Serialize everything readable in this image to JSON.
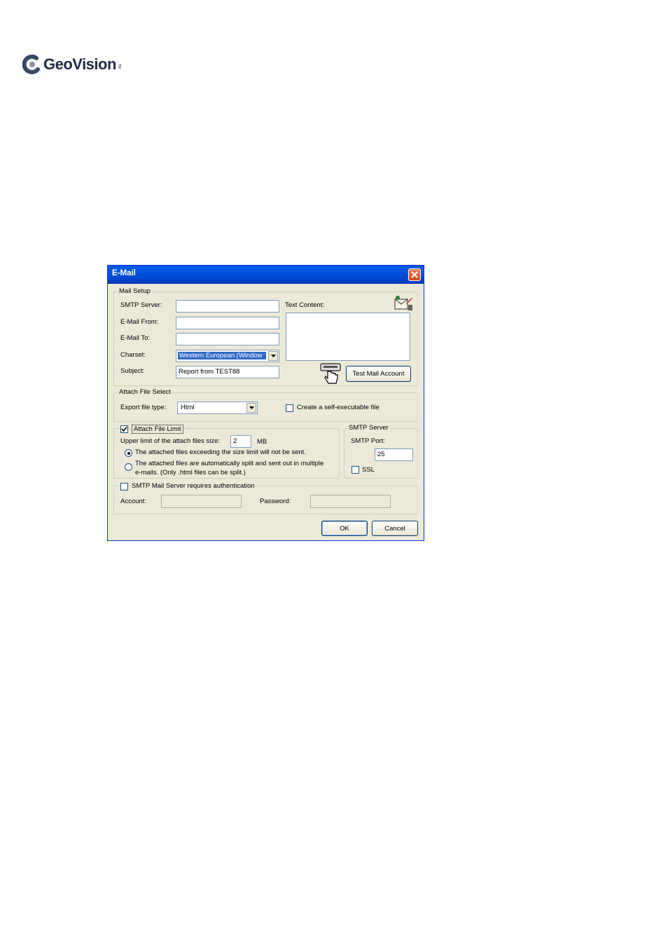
{
  "brand": {
    "name": "GeoVision",
    "tm": "TM"
  },
  "dialog": {
    "title": "E-Mail",
    "mail_setup": {
      "group_label": "Mail Setup",
      "smtp_server_label": "SMTP Server:",
      "smtp_server_value": "",
      "email_from_label": "E-Mail From:",
      "email_from_value": "",
      "email_to_label": "E-Mail To:",
      "email_to_value": "",
      "charset_label": "Charset:",
      "charset_value": "Western European (Window",
      "subject_label": "Subject:",
      "subject_value": "Report from TEST88",
      "text_content_label": "Text Content:",
      "text_content_value": "",
      "test_button_label": "Test Mail Account"
    },
    "attach_file_select": {
      "group_label": "Attach File Select",
      "export_type_label": "Export file type:",
      "export_type_value": "Html",
      "self_exec_label": "Create a self-executable file",
      "self_exec_checked": false
    },
    "attach_file_limit": {
      "label": "Attach File Limit",
      "checked": true,
      "upper_limit_label": "Upper limit of the attach files size:",
      "upper_limit_value": "2",
      "unit": "MB",
      "option1": "The attached files exceeding the size limit will not be sent.",
      "option2_line1": "The attached files are automatically split and sent out in multiple",
      "option2_line2": "e-mails. (Only .html files can be split.)",
      "selected_option": 1
    },
    "smtp_server": {
      "group_label": "SMTP Server",
      "port_label": "SMTP Port:",
      "port_value": "25",
      "ssl_label": "SSL",
      "ssl_checked": false
    },
    "auth": {
      "label": "SMTP Mail Server requires authentication",
      "checked": false,
      "account_label": "Account:",
      "account_value": "",
      "password_label": "Password:",
      "password_value": ""
    },
    "ok_label": "OK",
    "cancel_label": "Cancel"
  },
  "colors": {
    "titlebar": "#0055e5",
    "dialog_bg": "#ece9d8",
    "brand": "#1f2a44",
    "selection": "#316ac5"
  }
}
